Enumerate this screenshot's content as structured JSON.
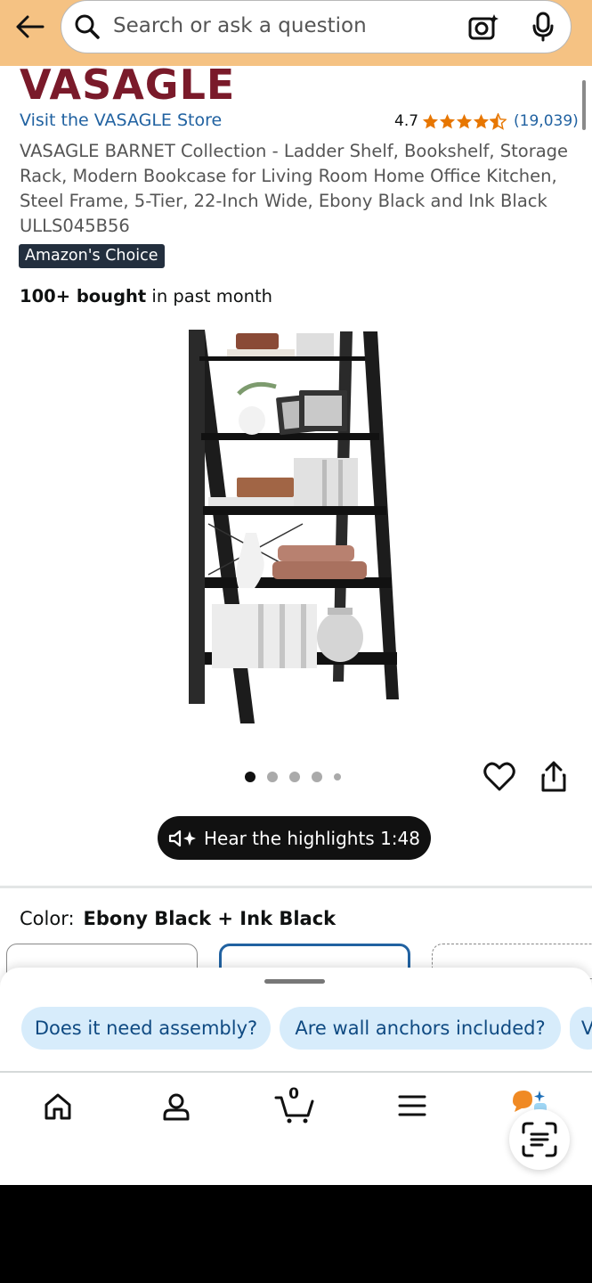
{
  "search": {
    "placeholder": "Search or ask a question"
  },
  "product": {
    "brand_logo": "VASAGLE",
    "store_link": "Visit the VASAGLE Store",
    "rating_value": "4.7",
    "rating_count": "(19,039)",
    "rating_stars": 4.5,
    "title": "VASAGLE BARNET Collection - Ladder Shelf, Bookshelf, Storage Rack, Modern Bookcase for Living Room Home Office Kitchen, Steel Frame, 5-Tier, 22-Inch Wide, Ebony Black and Ink Black ULLS045B56",
    "badge": "Amazon's Choice",
    "bought_bold": "100+ bought",
    "bought_rest": " in past month",
    "image_count": 5,
    "active_image": 1
  },
  "highlights": {
    "label": "Hear the highlights 1:48"
  },
  "color": {
    "label": "Color:",
    "value": "Ebony Black + Ink Black"
  },
  "suggestions": [
    "Does it need assembly?",
    "Are wall anchors included?",
    "V"
  ],
  "navbar": {
    "cart_count": "0"
  },
  "colors": {
    "topbar": "#f5c283",
    "link": "#2162a1",
    "star": "#e77600",
    "badge": "#232f3e"
  }
}
